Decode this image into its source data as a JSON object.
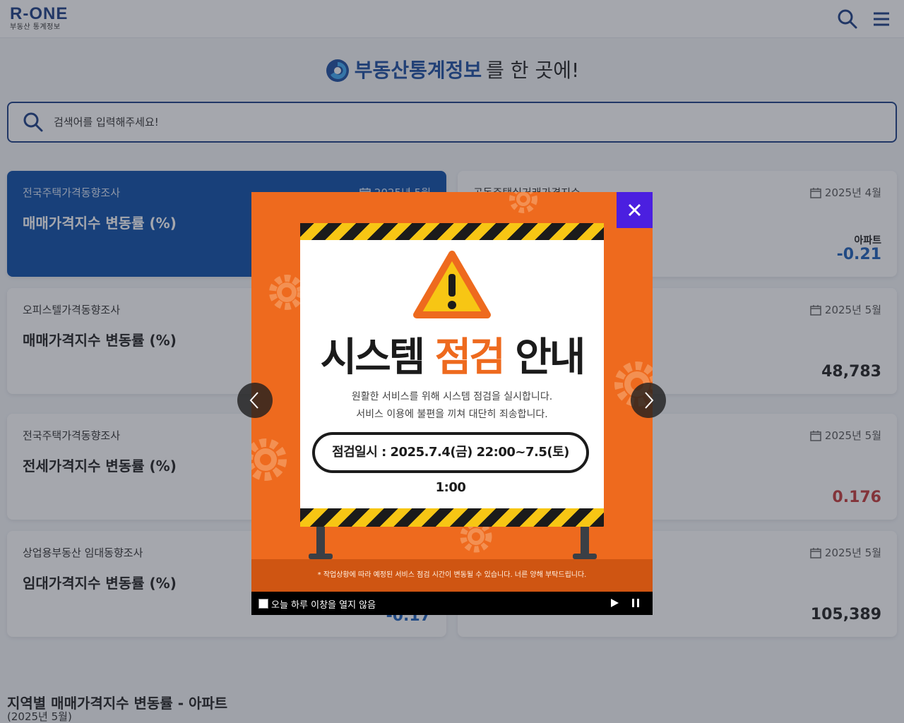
{
  "header": {
    "logo": "R-ONE",
    "logo_sub": "부동산 통계정보",
    "search_icon": "search-icon",
    "menu_icon": "hamburger-menu-icon"
  },
  "hero": {
    "strong": "부동산통계정보",
    "rest": "를 한 곳에!"
  },
  "search": {
    "placeholder": "검색어를 입력해주세요!"
  },
  "cards": [
    {
      "category": "전국주택가격동향조사",
      "title": "매매가격지수 변동률 (%)",
      "date": "2025년 5월",
      "sub": "",
      "value": ""
    },
    {
      "category": "공동주택실거래가격지수",
      "title": "",
      "date": "2025년 4월",
      "sub": "아파트",
      "value": "-0.21"
    },
    {
      "category": "오피스텔가격동향조사",
      "title": "매매가격지수 변동률 (%)",
      "date": "",
      "sub": "",
      "value": ""
    },
    {
      "category": "",
      "title": "",
      "date": "2025년 5월",
      "sub": "",
      "value": "48,783"
    },
    {
      "category": "전국주택가격동향조사",
      "title": "전세가격지수 변동률 (%)",
      "date": "",
      "sub": "",
      "value": ""
    },
    {
      "category": "",
      "title": "",
      "date": "2025년 5월",
      "sub": "",
      "value": "0.176"
    },
    {
      "category": "상업용부동산 임대동향조사",
      "title": "임대가격지수 변동률 (%)",
      "date": "",
      "sub": "",
      "value": "-0.17"
    },
    {
      "category": "",
      "title": "",
      "date": "2025년 5월",
      "sub": "",
      "value": "105,389"
    }
  ],
  "section": {
    "title": "지역별 매매가격지수 변동률 - 아파트",
    "sub": "(2025년 5월)"
  },
  "popup": {
    "title_black1": "시스템",
    "title_orange": "점검",
    "title_black2": "안내",
    "desc_line1": "원활한 서비스를 위해 시스템 점검을 실시합니다.",
    "desc_line2": "서비스 이용에 불편을 끼쳐 대단히 죄송합니다.",
    "schedule": "점검일시 : 2025.7.4(금) 22:00~7.5(토) 1:00",
    "footnote": "* 작업상황에 따라 예정된 서비스 점검 시간이 변동될 수 있습니다. 너른 양해 부탁드립니다.",
    "dont_show_label": "오늘 하루 이창을 열지 않음",
    "close_icon": "close-icon",
    "play_icon": "play-icon",
    "pause_icon": "pause-icon",
    "prev_icon": "chevron-left-icon",
    "next_icon": "chevron-right-icon",
    "warning_icon": "warning-triangle-icon"
  },
  "colors": {
    "brand_navy": "#1d3f86",
    "card_blue": "#0d4fa8",
    "popup_orange": "#ee6a1e",
    "close_purple": "#4b1fe0",
    "value_negative": "#1d5fb8",
    "value_positive": "#c43a3a"
  }
}
